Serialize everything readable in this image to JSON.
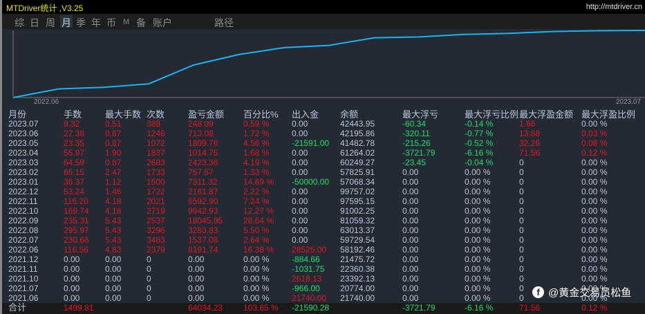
{
  "title": "MTDriver统计 ,V3.25",
  "url": "http://mtdriver.cn",
  "tabs": [
    {
      "label": "综"
    },
    {
      "label": "日"
    },
    {
      "label": "周"
    },
    {
      "label": "月",
      "active": true
    },
    {
      "label": "季"
    },
    {
      "label": "年"
    },
    {
      "label": "币"
    },
    {
      "label": "M"
    },
    {
      "label": "备"
    },
    {
      "label": "账户"
    },
    {
      "label": "路径"
    }
  ],
  "chart": {
    "x_start": "2022.06",
    "x_end": "2023.07",
    "line_color": "#19b4f0",
    "cumulative_profit": [
      0,
      8191.74,
      9728.82,
      13012.65,
      31058.6,
      41001.53,
      47594.43,
      49756.3,
      57067.62,
      57825.19,
      60248.55,
      61263.3,
      63073.06,
      63786.14,
      64034.23
    ]
  },
  "table": {
    "headers": [
      "月份",
      "手数",
      "最大手数",
      "次数",
      "盈亏金额",
      "百分比%",
      "出入金",
      "余额",
      "最大浮亏",
      "最大浮亏比例",
      "最大浮盈金额",
      "最大浮盈比例"
    ],
    "rows": [
      [
        "2023.07",
        "9.32",
        "0.51",
        "388",
        "248.09",
        "0.59 %",
        "0.00",
        "42443.95",
        "-60.34",
        "-0.14 %",
        "1.66",
        "0.00 %"
      ],
      [
        "2023.06",
        "27.38",
        "0.87",
        "1246",
        "713.08",
        "1.72 %",
        "0.00",
        "42195.86",
        "-320.11",
        "-0.77 %",
        "13.68",
        "0.03 %"
      ],
      [
        "2023.05",
        "23.35",
        "0.87",
        "1072",
        "1809.76",
        "4.56 %",
        "-21591.00",
        "41482.78",
        "-215.26",
        "-0.52 %",
        "32.26",
        "0.08 %"
      ],
      [
        "2023.04",
        "55.97",
        "1.90",
        "1837",
        "1014.75",
        "1.68 %",
        "0.00",
        "61264.02",
        "-3721.79",
        "-6.16 %",
        "71.56",
        "0.12 %"
      ],
      [
        "2023.03",
        "64.59",
        "0.87",
        "2683",
        "2423.36",
        "4.19 %",
        "0.00",
        "60249.27",
        "-23.45",
        "-0.04 %",
        "0",
        "0.00 %"
      ],
      [
        "2023.02",
        "65.15",
        "2.47",
        "1733",
        "757.57",
        "1.33 %",
        "0.00",
        "57825.91",
        "0.00",
        "0.00 %",
        "0",
        "0.00 %"
      ],
      [
        "2023.01",
        "36.37",
        "1.12",
        "1500",
        "7311.32",
        "14.69 %",
        "-50000.00",
        "57068.34",
        "0.00",
        "0.00 %",
        "0",
        "0.00 %"
      ],
      [
        "2022.12",
        "53.24",
        "1.46",
        "1722",
        "2161.87",
        "2.22 %",
        "0.00",
        "99757.02",
        "0.00",
        "0.00 %",
        "0",
        "0.00 %"
      ],
      [
        "2022.11",
        "116.20",
        "4.18",
        "2021",
        "6592.90",
        "7.24 %",
        "0.00",
        "97595.15",
        "0.00",
        "0.00 %",
        "0",
        "0.00 %"
      ],
      [
        "2022.10",
        "169.74",
        "4.18",
        "2719",
        "9942.93",
        "12.27 %",
        "0.00",
        "91002.25",
        "0.00",
        "0.00 %",
        "0",
        "0.00 %"
      ],
      [
        "2022.09",
        "235.31",
        "5.43",
        "2537",
        "18045.95",
        "28.64 %",
        "0.00",
        "81059.32",
        "0.00",
        "0.00 %",
        "0",
        "0.00 %"
      ],
      [
        "2022.08",
        "295.97",
        "5.43",
        "3296",
        "3283.83",
        "5.50 %",
        "0.00",
        "63013.37",
        "0.00",
        "0.00 %",
        "0",
        "0.00 %"
      ],
      [
        "2022.07",
        "230.66",
        "5.43",
        "3483",
        "1537.08",
        "2.64 %",
        "0.00",
        "59729.54",
        "0.00",
        "0.00 %",
        "0",
        "0.00 %"
      ],
      [
        "2022.06",
        "116.56",
        "4.83",
        "2379",
        "8191.74",
        "16.38 %",
        "28525.00",
        "58192.46",
        "0.00",
        "0.00 %",
        "0",
        "0.00 %"
      ],
      [
        "2021.12",
        "0.00",
        "0.00",
        "0",
        "0.00",
        "0.00 %",
        "-884.66",
        "21475.72",
        "0.00",
        "0.00 %",
        "0",
        "0.00 %"
      ],
      [
        "2021.11",
        "0.00",
        "0.00",
        "0",
        "0.00",
        "0.00 %",
        "-1031.75",
        "22360.38",
        "0.00",
        "0.00 %",
        "0",
        "0.00 %"
      ],
      [
        "2021.10",
        "0.00",
        "0.00",
        "0",
        "0.00",
        "0.00 %",
        "2618.13",
        "23392.13",
        "0.00",
        "0.00 %",
        "0",
        "0.00 %"
      ],
      [
        "2021.07",
        "0.00",
        "0.00",
        "0",
        "0.00",
        "0.00 %",
        "-966.00",
        "20774.00",
        "0.00",
        "0.00 %",
        "0",
        "0.00 %"
      ],
      [
        "2021.06",
        "0.00",
        "0.00",
        "0",
        "0.00",
        "0.00 %",
        "21740.00",
        "21740.00",
        "0.00",
        "0.00 %",
        "0",
        "0.00 %"
      ]
    ],
    "total": [
      "合计",
      "1499.81",
      "",
      "",
      "64034.23",
      "103.65 %",
      "-21590.28",
      "",
      "-3721.79",
      "-6.16 %",
      "71.56",
      "0.12 %"
    ]
  },
  "watermark": "@黄金交易员松鱼",
  "colors": {
    "positive": "#e8141e",
    "negative": "#18e068",
    "neutral": "#b8c4d6"
  }
}
